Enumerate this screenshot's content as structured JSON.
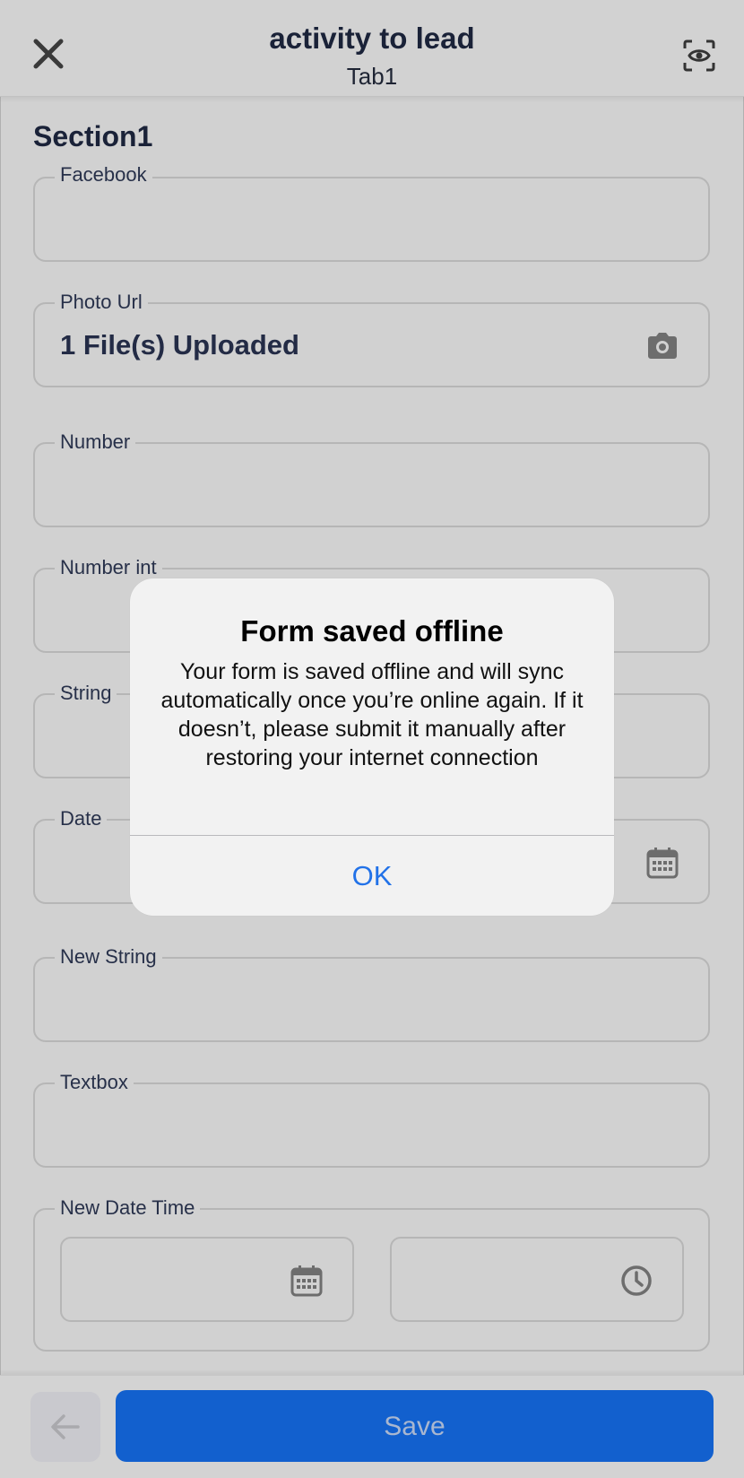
{
  "header": {
    "title": "activity to lead",
    "subtitle": "Tab1"
  },
  "section": {
    "title": "Section1"
  },
  "fields": {
    "facebook": {
      "label": "Facebook",
      "value": ""
    },
    "photo_url": {
      "label": "Photo Url",
      "value": "1 File(s) Uploaded"
    },
    "number": {
      "label": "Number",
      "value": ""
    },
    "number_int": {
      "label": "Number int",
      "value": ""
    },
    "string": {
      "label": "String",
      "value": ""
    },
    "date": {
      "label": "Date",
      "value": ""
    },
    "new_string": {
      "label": "New String",
      "value": ""
    },
    "textbox": {
      "label": "Textbox",
      "value": ""
    },
    "new_date_time": {
      "label": "New Date Time",
      "date_value": "",
      "time_value": ""
    }
  },
  "footer": {
    "save_label": "Save"
  },
  "dialog": {
    "title": "Form saved offline",
    "message": "Your form is saved offline and will sync automatically once you’re online again. If it doesn’t, please submit it manually after restoring your internet connection",
    "ok_label": "OK"
  },
  "colors": {
    "accent": "#1260ce",
    "dialog_button": "#2272e8"
  }
}
